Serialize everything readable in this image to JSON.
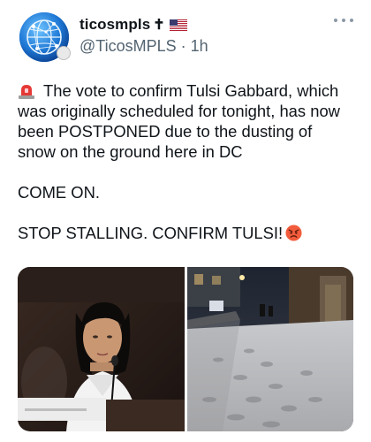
{
  "post": {
    "display_name": "ticosmpls",
    "name_glyph": "✝",
    "handle": "@TicosMPLS",
    "separator": "·",
    "time": "1h",
    "lines": [
      "The vote to confirm Tulsi Gabbard, which",
      "was originally scheduled for tonight, has now",
      "been POSTPONED due to the dusting of",
      "snow on the ground here in DC"
    ],
    "line2": "COME ON.",
    "line3": "STOP STALLING. CONFIRM TULSI!"
  },
  "icons": {
    "avatar": "globe-logo",
    "flag": "us-flag-emoji",
    "more": "more-horizontal-icon",
    "siren": "rotating-light-emoji",
    "angry": "angry-face-emoji"
  },
  "colors": {
    "text": "#0f1419",
    "secondary": "#536471",
    "avatar_blue": "#1b6fc9"
  }
}
